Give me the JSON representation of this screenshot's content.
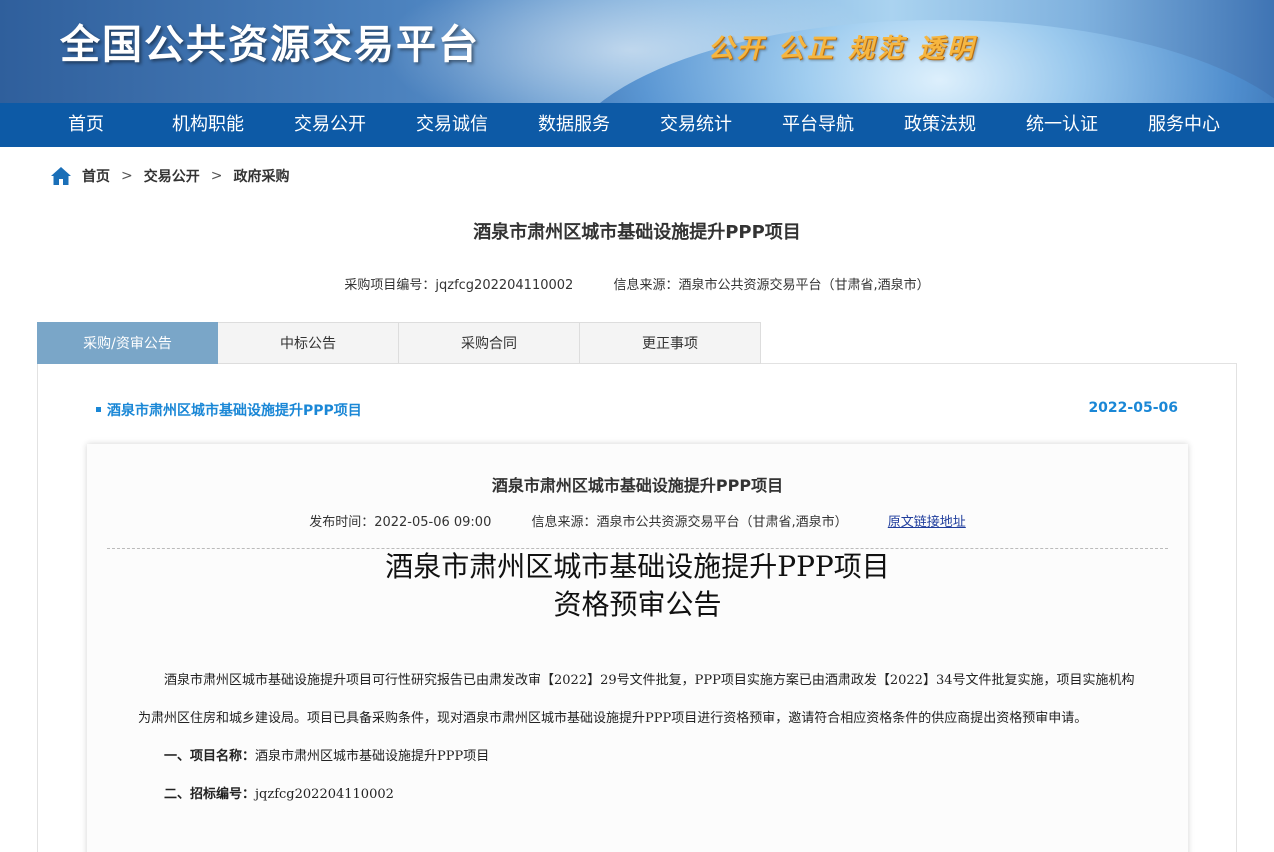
{
  "banner": {
    "site_title": "全国公共资源交易平台",
    "slogan": "公开 公正 规范 透明"
  },
  "nav": {
    "items": [
      {
        "label": "首页"
      },
      {
        "label": "机构职能"
      },
      {
        "label": "交易公开"
      },
      {
        "label": "交易诚信"
      },
      {
        "label": "数据服务"
      },
      {
        "label": "交易统计"
      },
      {
        "label": "平台导航"
      },
      {
        "label": "政策法规"
      },
      {
        "label": "统一认证"
      },
      {
        "label": "服务中心"
      }
    ]
  },
  "breadcrumb": {
    "home": "首页",
    "level1": "交易公开",
    "level2": "政府采购",
    "separator": ">"
  },
  "page": {
    "title": "酒泉市肃州区城市基础设施提升PPP项目",
    "project_code": "采购项目编号：jqzfcg202204110002",
    "source": "信息来源：酒泉市公共资源交易平台（甘肃省,酒泉市）"
  },
  "tabs": [
    {
      "label": "采购/资审公告",
      "active": true
    },
    {
      "label": "中标公告",
      "active": false
    },
    {
      "label": "采购合同",
      "active": false
    },
    {
      "label": "更正事项",
      "active": false
    }
  ],
  "notice": {
    "title": "酒泉市肃州区城市基础设施提升PPP项目",
    "date": "2022-05-06"
  },
  "card": {
    "title": "酒泉市肃州区城市基础设施提升PPP项目",
    "publish_time": "发布时间：2022-05-06 09:00",
    "source": "信息来源：酒泉市公共资源交易平台（甘肃省,酒泉市）",
    "link": "原文链接地址",
    "heading_line1": "酒泉市肃州区城市基础设施提升PPP项目",
    "heading_line2": "资格预审公告",
    "paragraph": "酒泉市肃州区城市基础设施提升项目可行性研究报告已由肃发改审【2022】29号文件批复，PPP项目实施方案已由酒肃政发【2022】34号文件批复实施，项目实施机构为肃州区住房和城乡建设局。项目已具备采购条件，现对酒泉市肃州区城市基础设施提升PPP项目进行资格预审，邀请符合相应资格条件的供应商提出资格预审申请。",
    "item1_label": "一、项目名称：",
    "item1_value": "酒泉市肃州区城市基础设施提升PPP项目",
    "item2_label": "二、招标编号：",
    "item2_value": "jqzfcg202204110002"
  },
  "colors": {
    "nav_bg": "#0d5aa6",
    "tab_active": "#7aa6c8",
    "link_blue": "#1a87d6",
    "slogan": "#f6b640"
  }
}
